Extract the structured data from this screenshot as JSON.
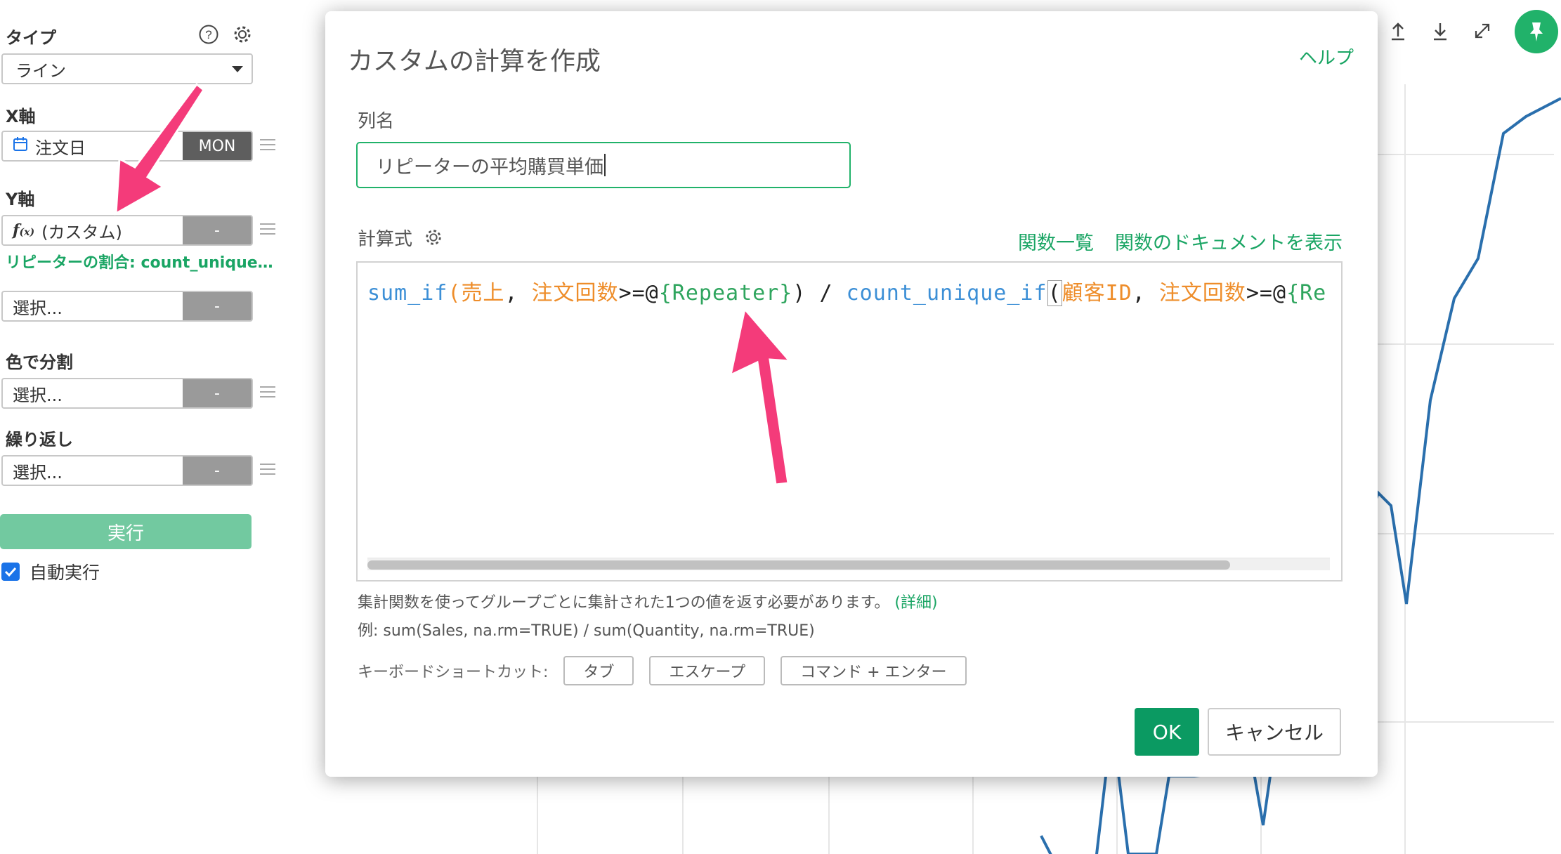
{
  "left_panel": {
    "type_label": "タイプ",
    "type_value": "ライン",
    "x_axis_label": "X軸",
    "x_axis_field": "注文日",
    "x_axis_unit": "MON",
    "y_axis_label": "Y軸",
    "y_axis_fx": "f(x)",
    "y_axis_field": "(カスタム)",
    "y_axis_button": "-",
    "y_axis_column_name": "リピーターの割合: count_unique…",
    "y_axis_second_placeholder": "選択...",
    "y_axis_second_button": "-",
    "color_label": "色で分割",
    "color_placeholder": "選択...",
    "color_button": "-",
    "repeat_label": "繰り返し",
    "repeat_placeholder": "選択...",
    "repeat_button": "-",
    "run_button": "実行",
    "auto_run_label": "自動実行",
    "auto_run_checked": true
  },
  "toolbar_icons": [
    "upload-icon",
    "download-icon",
    "expand-icon",
    "pin-icon"
  ],
  "modal": {
    "title": "カスタムの計算を作成",
    "help_link": "ヘルプ",
    "column_name_label": "列名",
    "column_name_value": "リピーターの平均購買単価",
    "formula_label": "計算式",
    "functions_link": "関数一覧",
    "docs_link": "関数のドキュメントを表示",
    "formula_tokens": [
      {
        "text": "sum_if",
        "kind": "fn"
      },
      {
        "text": "(",
        "kind": "ar"
      },
      {
        "text": "売上",
        "kind": "ar"
      },
      {
        "text": ", ",
        "kind": "op"
      },
      {
        "text": "注文回数",
        "kind": "ar"
      },
      {
        "text": ">=@",
        "kind": "op"
      },
      {
        "text": "{Repeater}",
        "kind": "gr"
      },
      {
        "text": ") / ",
        "kind": "op"
      },
      {
        "text": "count_unique_if",
        "kind": "fn"
      },
      {
        "text": "(",
        "kind": "cursor"
      },
      {
        "text": "顧客ID",
        "kind": "ar"
      },
      {
        "text": ", ",
        "kind": "op"
      },
      {
        "text": "注文回数",
        "kind": "ar"
      },
      {
        "text": ">=@",
        "kind": "op"
      },
      {
        "text": "{Re",
        "kind": "gr"
      }
    ],
    "hint_text": "集計関数を使ってグループごとに集計された1つの値を返す必要があります。",
    "hint_link": "(詳細)",
    "example_text": "例: sum(Sales, na.rm=TRUE) / sum(Quantity, na.rm=TRUE)",
    "shortcut_label": "キーボードショートカット:",
    "shortcut_keys": [
      "タブ",
      "エスケープ",
      "コマンド + エンター"
    ],
    "ok_button": "OK",
    "cancel_button": "キャンセル"
  },
  "colors": {
    "accent_green": "#1aa564",
    "ok_green": "#0b9a62",
    "line_blue": "#2a6fad",
    "arrow_pink": "#f43b7a"
  }
}
